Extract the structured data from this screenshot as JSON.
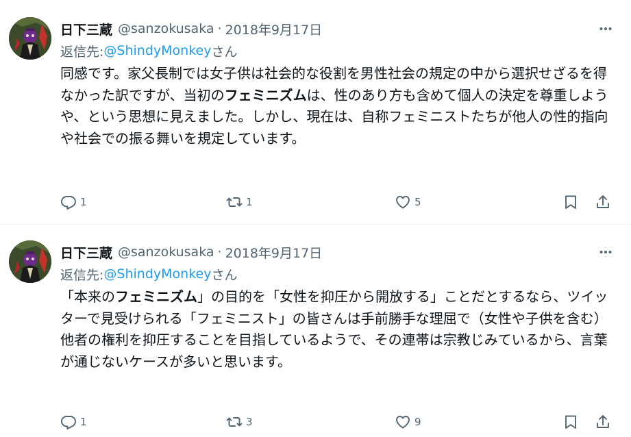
{
  "tweets": [
    {
      "author_name": "日下三蔵",
      "handle": "@sanzokusaka",
      "separator": "·",
      "date": "2018年9月17日",
      "reply_prefix": "返信先: ",
      "reply_to": "@ShindyMonkey",
      "reply_suffix": "さん",
      "text_parts": [
        "同感です。家父長制では女子供は社会的な役割を男性社会の規定の中から選択せざるを得なかった訳ですが、当初の",
        "フェミニズム",
        "は、性のあり方も含めて個人の決定を尊重しようや、という思想に見えました。しかし、現在は、自称フェミニストたちが他人の性的指向や社会での振る舞いを規定しています。"
      ],
      "replies": "1",
      "retweets": "1",
      "likes": "5"
    },
    {
      "author_name": "日下三蔵",
      "handle": "@sanzokusaka",
      "separator": "·",
      "date": "2018年9月17日",
      "reply_prefix": "返信先: ",
      "reply_to": "@ShindyMonkey",
      "reply_suffix": "さん",
      "text_parts": [
        "「本来の",
        "フェミニズム",
        "」の目的を「女性を抑圧から開放する」ことだとするなら、ツイッターで見受けられる「フェミニスト」の皆さんは手前勝手な理屈で（女性や子供を含む）他者の権利を抑圧することを目指しているようで、その連帯は宗教じみているから、言葉が通じないケースが多いと思います。"
      ],
      "replies": "1",
      "retweets": "3",
      "likes": "9"
    }
  ],
  "icons": {
    "more": "more-icon",
    "reply": "reply-icon",
    "retweet": "retweet-icon",
    "like": "heart-icon",
    "bookmark": "bookmark-icon",
    "share": "share-icon"
  },
  "colors": {
    "text_primary": "#0f1419",
    "text_secondary": "#536471",
    "link": "#1d9bf0",
    "divider": "#eff3f4"
  }
}
